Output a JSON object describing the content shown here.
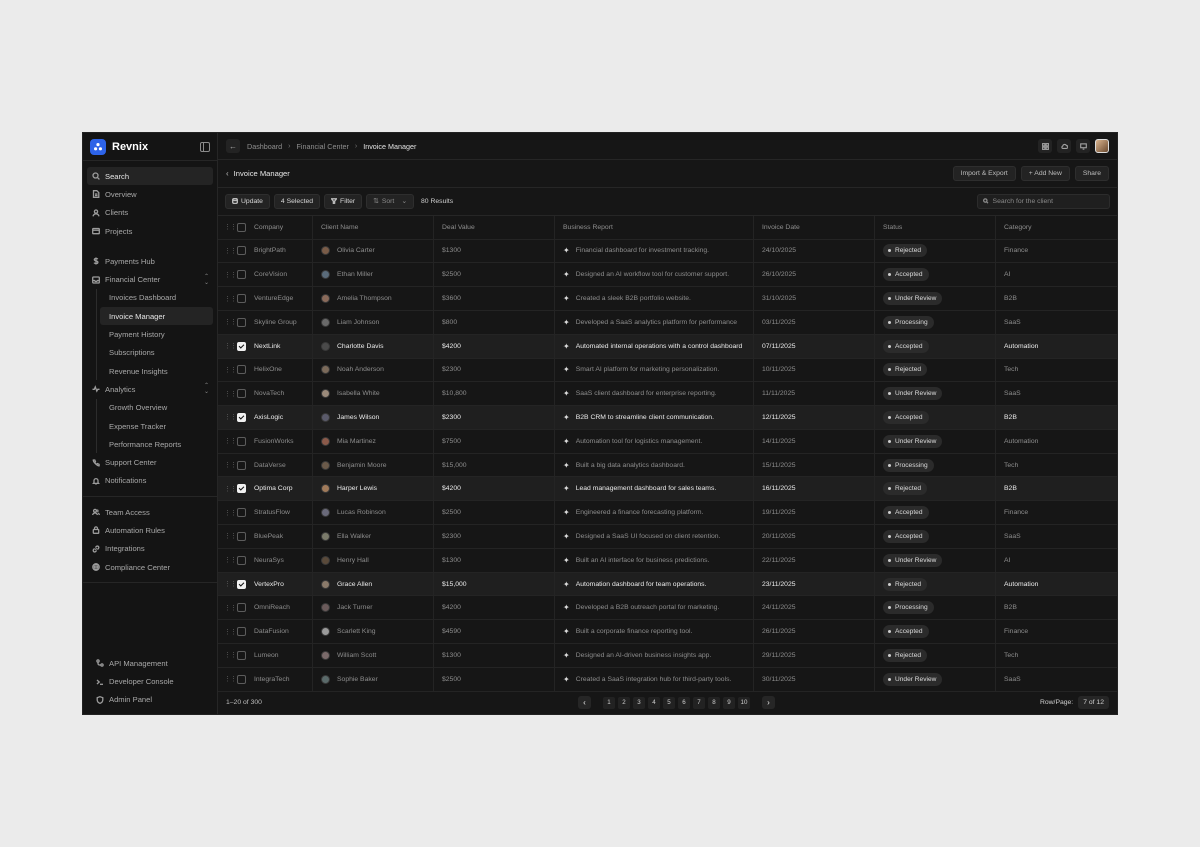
{
  "brand": {
    "name": "Revnix"
  },
  "sidebar": {
    "search_label": "Search",
    "main_items": [
      {
        "label": "Overview",
        "icon": "file-icon"
      },
      {
        "label": "Clients",
        "icon": "user-icon"
      },
      {
        "label": "Projects",
        "icon": "folder-icon"
      }
    ],
    "payments_hub": "Payments Hub",
    "financial_center": {
      "label": "Financial Center",
      "children": [
        "Invoices Dashboard",
        "Invoice Manager",
        "Payment History",
        "Subscriptions",
        "Revenue Insights"
      ],
      "active": "Invoice Manager"
    },
    "analytics": {
      "label": "Analytics",
      "children": [
        "Growth Overview",
        "Expense Tracker",
        "Performance Reports"
      ]
    },
    "support_center": "Support Center",
    "notifications": "Notifications",
    "team_items": [
      "Team Access",
      "Automation Rules",
      "Integrations",
      "Compliance Center"
    ],
    "bottom_items": [
      "API Management",
      "Developer Console",
      "Admin Panel"
    ]
  },
  "breadcrumb": [
    "Dashboard",
    "Financial Center",
    "Invoice Manager"
  ],
  "page": {
    "title": "Invoice Manager",
    "actions": [
      "Import & Export",
      "+ Add New",
      "Share"
    ]
  },
  "toolbar": {
    "update": "Update",
    "selected": "4 Selected",
    "filter": "Filter",
    "sort": "Sort",
    "results": "80 Results",
    "search_placeholder": "Search for the client"
  },
  "table": {
    "columns": [
      "Company",
      "Client Name",
      "Deal Value",
      "Business Report",
      "Invoice Date",
      "Status",
      "Category"
    ],
    "rows": [
      {
        "company": "BrightPath",
        "client": "Olivia Carter",
        "deal": "$1300",
        "report": "Financial dashboard for investment tracking.",
        "date": "24/10/2025",
        "status": "Rejected",
        "category": "Finance",
        "selected": false
      },
      {
        "company": "CoreVision",
        "client": "Ethan Miller",
        "deal": "$2500",
        "report": "Designed an AI workflow tool for customer support.",
        "date": "26/10/2025",
        "status": "Accepted",
        "category": "AI",
        "selected": false
      },
      {
        "company": "VentureEdge",
        "client": "Amelia Thompson",
        "deal": "$3600",
        "report": "Created a sleek B2B portfolio website.",
        "date": "31/10/2025",
        "status": "Under Review",
        "category": "B2B",
        "selected": false
      },
      {
        "company": "Skyline Group",
        "client": "Liam Johnson",
        "deal": "$800",
        "report": "Developed a SaaS analytics platform for performance",
        "date": "03/11/2025",
        "status": "Processing",
        "category": "SaaS",
        "selected": false
      },
      {
        "company": "NextLink",
        "client": "Charlotte Davis",
        "deal": "$4200",
        "report": "Automated internal operations with a control dashboard",
        "date": "07/11/2025",
        "status": "Accepted",
        "category": "Automation",
        "selected": true
      },
      {
        "company": "HelixOne",
        "client": "Noah Anderson",
        "deal": "$2300",
        "report": "Smart AI platform for marketing personalization.",
        "date": "10/11/2025",
        "status": "Rejected",
        "category": "Tech",
        "selected": false
      },
      {
        "company": "NovaTech",
        "client": "Isabella White",
        "deal": "$10,800",
        "report": "SaaS client dashboard for enterprise reporting.",
        "date": "11/11/2025",
        "status": "Under Review",
        "category": "SaaS",
        "selected": false
      },
      {
        "company": "AxisLogic",
        "client": "James Wilson",
        "deal": "$2300",
        "report": "B2B CRM to streamline client communication.",
        "date": "12/11/2025",
        "status": "Accepted",
        "category": "B2B",
        "selected": true
      },
      {
        "company": "FusionWorks",
        "client": "Mia Martinez",
        "deal": "$7500",
        "report": "Automation tool for logistics management.",
        "date": "14/11/2025",
        "status": "Under Review",
        "category": "Automation",
        "selected": false
      },
      {
        "company": "DataVerse",
        "client": "Benjamin Moore",
        "deal": "$15,000",
        "report": "Built a big data analytics dashboard.",
        "date": "15/11/2025",
        "status": "Processing",
        "category": "Tech",
        "selected": false
      },
      {
        "company": "Optima Corp",
        "client": "Harper Lewis",
        "deal": "$4200",
        "report": "Lead management dashboard for sales teams.",
        "date": "16/11/2025",
        "status": "Rejected",
        "category": "B2B",
        "selected": true
      },
      {
        "company": "StratusFlow",
        "client": "Lucas Robinson",
        "deal": "$2500",
        "report": "Engineered a finance forecasting platform.",
        "date": "19/11/2025",
        "status": "Accepted",
        "category": "Finance",
        "selected": false
      },
      {
        "company": "BluePeak",
        "client": "Ella Walker",
        "deal": "$2300",
        "report": "Designed a SaaS UI focused on client retention.",
        "date": "20/11/2025",
        "status": "Accepted",
        "category": "SaaS",
        "selected": false
      },
      {
        "company": "NeuraSys",
        "client": "Henry Hall",
        "deal": "$1300",
        "report": "Built an AI interface for business predictions.",
        "date": "22/11/2025",
        "status": "Under Review",
        "category": "AI",
        "selected": false
      },
      {
        "company": "VertexPro",
        "client": "Grace Allen",
        "deal": "$15,000",
        "report": "Automation dashboard for team operations.",
        "date": "23/11/2025",
        "status": "Rejected",
        "category": "Automation",
        "selected": true
      },
      {
        "company": "OmniReach",
        "client": "Jack Turner",
        "deal": "$4200",
        "report": "Developed a B2B outreach portal for marketing.",
        "date": "24/11/2025",
        "status": "Processing",
        "category": "B2B",
        "selected": false
      },
      {
        "company": "DataFusion",
        "client": "Scarlett King",
        "deal": "$4590",
        "report": "Built a corporate finance reporting tool.",
        "date": "26/11/2025",
        "status": "Accepted",
        "category": "Finance",
        "selected": false
      },
      {
        "company": "Lumeon",
        "client": "William Scott",
        "deal": "$1300",
        "report": "Designed an AI-driven business insights app.",
        "date": "29/11/2025",
        "status": "Rejected",
        "category": "Tech",
        "selected": false
      },
      {
        "company": "IntegraTech",
        "client": "Sophie Baker",
        "deal": "$2500",
        "report": "Created a SaaS integration hub for third-party tools.",
        "date": "30/11/2025",
        "status": "Under Review",
        "category": "SaaS",
        "selected": false
      }
    ]
  },
  "pagination": {
    "range": "1–20 of 300",
    "pages": [
      "1",
      "2",
      "3",
      "4",
      "5",
      "6",
      "7",
      "8",
      "9",
      "10"
    ],
    "rows_per_page_label": "Row/Page:",
    "rows_per_page_value": "7 of 12"
  },
  "colors": {
    "accent": "#2d63e8",
    "background": "#161616",
    "sidebar": "#141414"
  }
}
